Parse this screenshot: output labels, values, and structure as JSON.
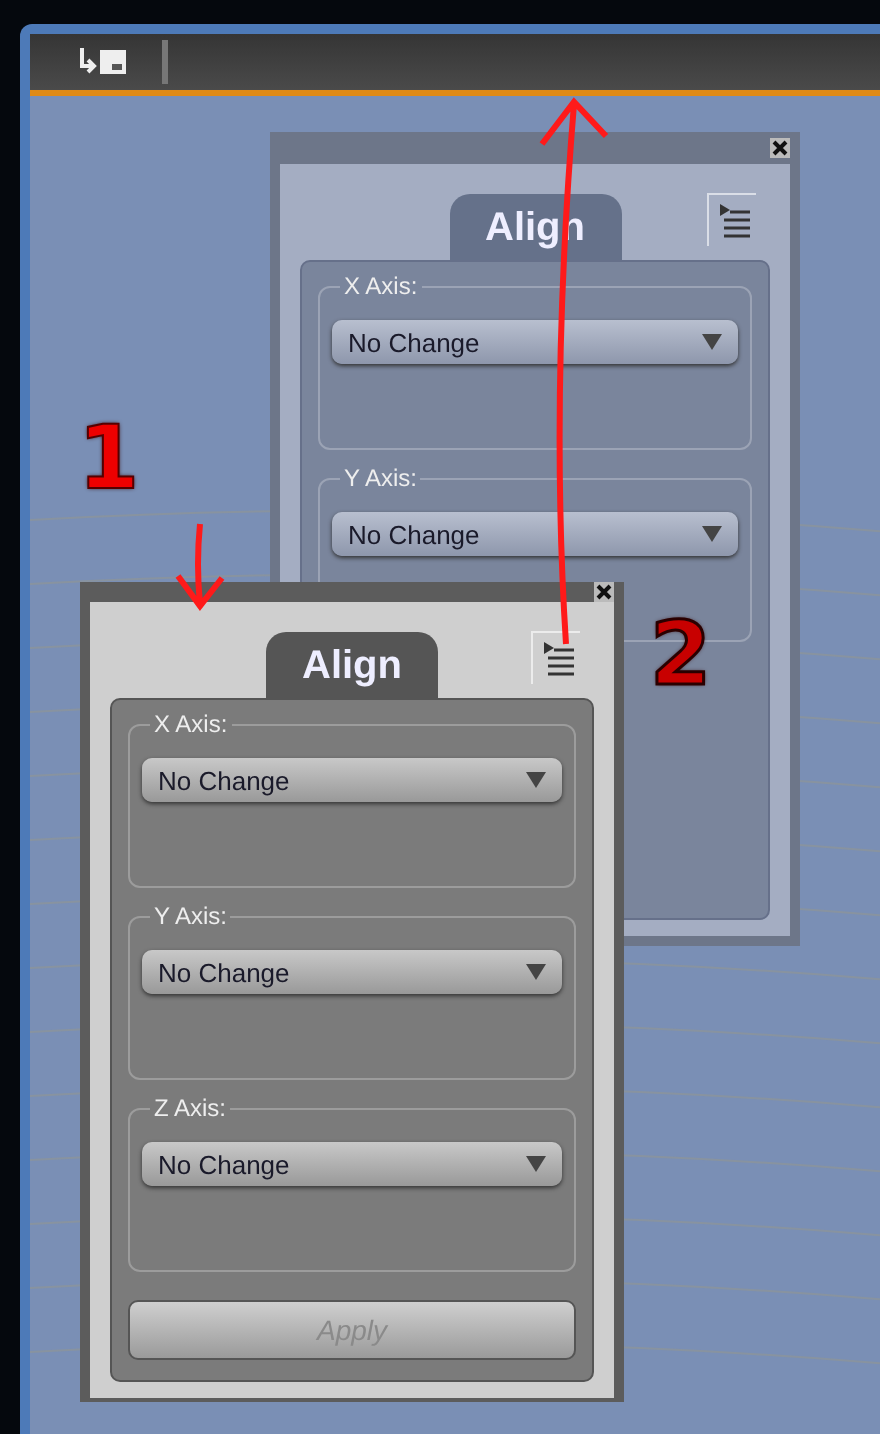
{
  "panels": [
    {
      "title": "Align",
      "axes": [
        {
          "label": "X Axis:",
          "value": "No Change"
        },
        {
          "label": "Y Axis:",
          "value": "No Change"
        }
      ]
    },
    {
      "title": "Align",
      "axes": [
        {
          "label": "X Axis:",
          "value": "No Change"
        },
        {
          "label": "Y Axis:",
          "value": "No Change"
        },
        {
          "label": "Z Axis:",
          "value": "No Change"
        }
      ],
      "apply": {
        "label": "Apply",
        "disabled": true
      }
    }
  ],
  "annotations": [
    {
      "text": "1",
      "kind": "one"
    },
    {
      "text": "2",
      "kind": "two"
    }
  ]
}
